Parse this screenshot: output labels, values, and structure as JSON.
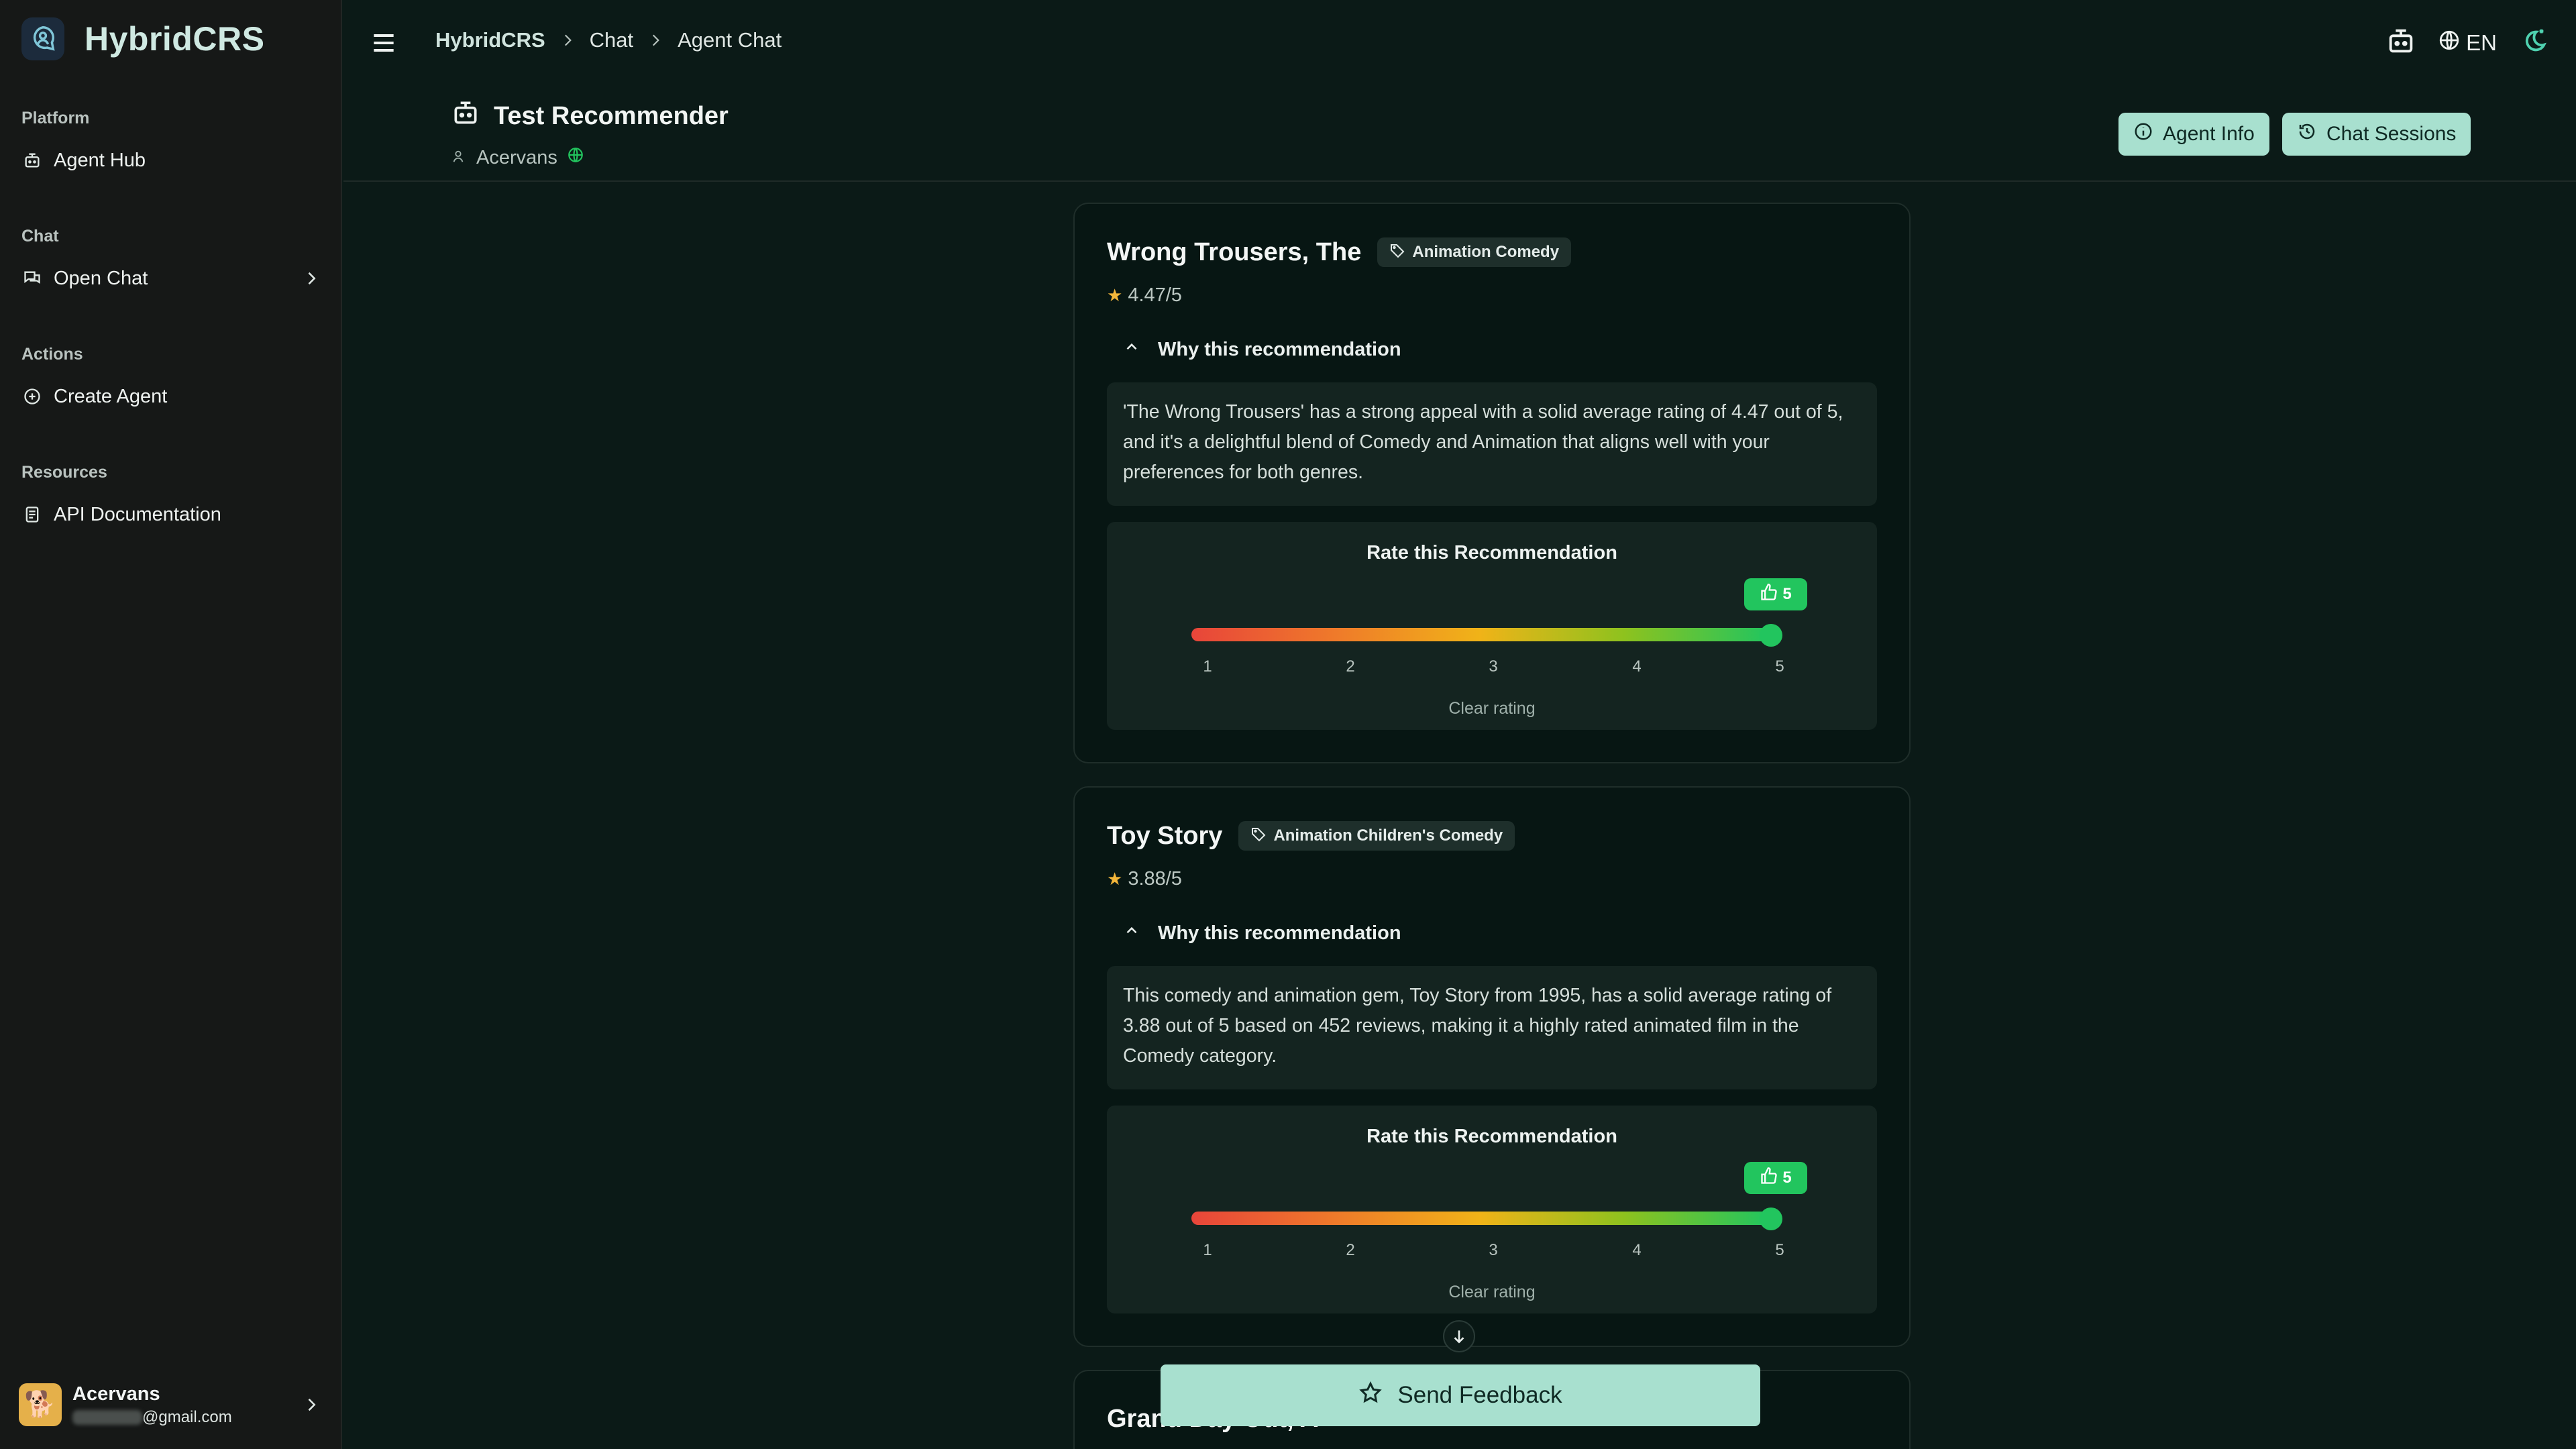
{
  "app": {
    "name": "HybridCRS"
  },
  "sidebar": {
    "groups": [
      {
        "title": "Platform",
        "items": [
          {
            "label": "Agent Hub",
            "icon": "robot-icon"
          }
        ]
      },
      {
        "title": "Chat",
        "items": [
          {
            "label": "Open Chat",
            "icon": "chat-icon"
          }
        ]
      },
      {
        "title": "Actions",
        "items": [
          {
            "label": "Create Agent",
            "icon": "plus-circle-icon"
          }
        ]
      },
      {
        "title": "Resources",
        "items": [
          {
            "label": "API Documentation",
            "icon": "document-icon"
          }
        ]
      }
    ],
    "user": {
      "name": "Acervans",
      "email_suffix": "@gmail.com"
    }
  },
  "topbar": {
    "breadcrumbs": [
      "HybridCRS",
      "Chat",
      "Agent Chat"
    ],
    "language": "EN"
  },
  "agent": {
    "title": "Test Recommender",
    "owner": "Acervans",
    "buttons": {
      "info": "Agent Info",
      "sessions": "Chat Sessions"
    }
  },
  "recommendations": [
    {
      "title": "Wrong Trousers, The",
      "genres": "Animation Comedy",
      "rating": "4.47/5",
      "why_label": "Why this recommendation",
      "explanation": "'The Wrong Trousers' has a strong appeal with a solid average rating of 4.47 out of 5, and it's a delightful blend of Comedy and Animation that aligns well with your preferences for both genres.",
      "rate_title": "Rate this Recommendation",
      "user_rating": 5,
      "clear_label": "Clear rating"
    },
    {
      "title": "Toy Story",
      "genres": "Animation Children's Comedy",
      "rating": "3.88/5",
      "why_label": "Why this recommendation",
      "explanation": "This comedy and animation gem, Toy Story from 1995, has a solid average rating of 3.88 out of 5 based on 452 reviews, making it a highly rated animated film in the Comedy category.",
      "rate_title": "Rate this Recommendation",
      "user_rating": 5,
      "clear_label": "Clear rating"
    }
  ],
  "scale_ticks": [
    "1",
    "2",
    "3",
    "4",
    "5"
  ],
  "third_card_partial_title": "Grand Day Out, A",
  "feedback_button": "Send Feedback",
  "colors": {
    "accent": "#a8e0cf",
    "success": "#22c55e",
    "background": "#0b1a17"
  }
}
